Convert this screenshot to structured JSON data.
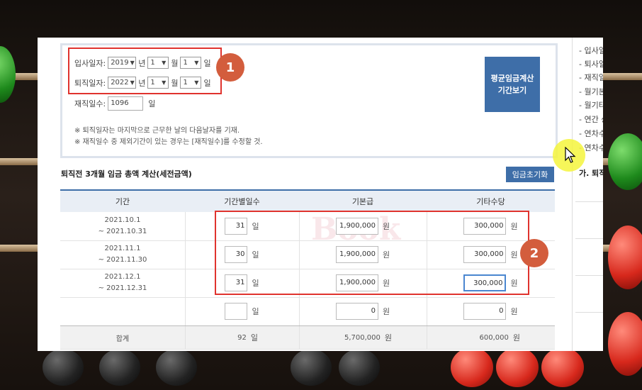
{
  "form": {
    "hire_label": "입사일자:",
    "hire_year": "2019",
    "hire_month": "1",
    "hire_day": "1",
    "retire_label": "퇴직일자:",
    "retire_year": "2022",
    "retire_month": "1",
    "retire_day": "1",
    "year_unit": "년",
    "month_unit": "월",
    "day_unit": "일",
    "days_label": "재직일수:",
    "days_value": "1096",
    "days_unit": "일",
    "note1": "※ 퇴직일자는 마지막으로 근무한 날의 다음날자를 기재.",
    "note2": "※ 재직일수 중 제외기간이 있는 경우는 [재직일수]를 수정할 것.",
    "avg_btn_line1": "평균임금계산",
    "avg_btn_line2": "기간보기"
  },
  "section": {
    "title": "퇴직전 3개월 임금 총액 계산(세전금액)",
    "reset_label": "임금초기화"
  },
  "table": {
    "headers": [
      "기간",
      "기간별일수",
      "기본급",
      "기타수당"
    ],
    "rows": [
      {
        "from": "2021.10.1",
        "to": "~ 2021.10.31",
        "days": "31",
        "base": "1,900,000",
        "other": "300,000"
      },
      {
        "from": "2021.11.1",
        "to": "~ 2021.11.30",
        "days": "30",
        "base": "1,900,000",
        "other": "300,000"
      },
      {
        "from": "2021.12.1",
        "to": "~ 2021.12.31",
        "days": "31",
        "base": "1,900,000",
        "other": "300,000"
      },
      {
        "from": "",
        "to": "",
        "days": "",
        "base": "0",
        "other": "0"
      }
    ],
    "day_unit": "일",
    "won_unit": "원",
    "total": {
      "label": "합계",
      "days": "92",
      "base": "5,700,000",
      "other": "600,000"
    }
  },
  "side": {
    "items": [
      "- 입사일",
      "- 퇴사일",
      "- 재직일",
      "- 월기본",
      "- 월기타",
      "- 연간 상",
      "- 연차수",
      "- 연차수"
    ],
    "header": "가. 퇴직"
  },
  "annotations": {
    "marker1": "1",
    "marker2": "2"
  },
  "watermark": "Book",
  "colors": {
    "accent": "#3e6ea8",
    "highlight": "#e0332e",
    "marker": "#d35d3d"
  }
}
